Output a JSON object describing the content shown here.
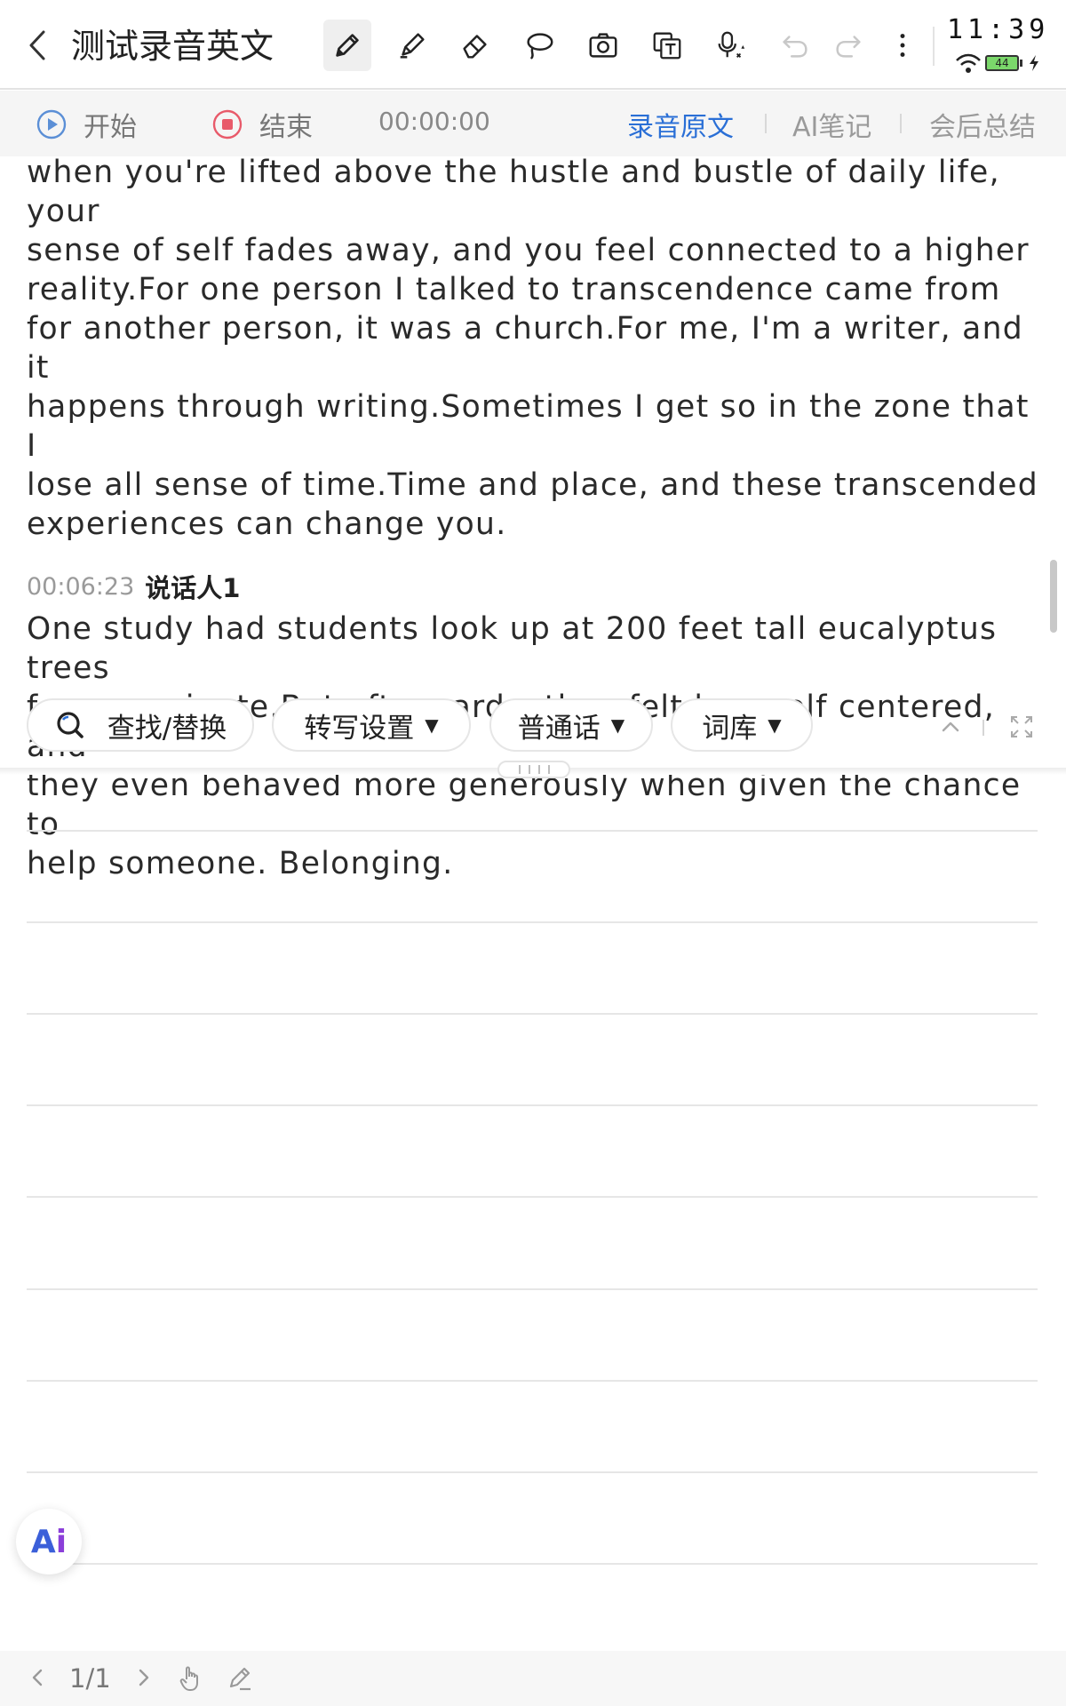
{
  "toolbar": {
    "title": "测试录音英文",
    "tools": [
      "pen-icon",
      "highlighter-icon",
      "eraser-icon",
      "lasso-icon",
      "camera-icon",
      "text-recognition-icon",
      "voice-input-icon",
      "undo-icon",
      "redo-icon",
      "more-icon"
    ]
  },
  "status": {
    "time": "11:39",
    "battery": "44"
  },
  "recording": {
    "start_label": "开始",
    "stop_label": "结束",
    "elapsed": "00:00:00",
    "tabs": [
      {
        "label": "录音原文",
        "active": true
      },
      {
        "label": "AI笔记",
        "active": false
      },
      {
        "label": "会后总结",
        "active": false
      }
    ]
  },
  "transcript": {
    "para1": "when you're lifted above the hustle and bustle of daily life, your\nsense of self fades away, and you feel connected to a higher\nreality.For one person I talked to transcendence came from\nfor another person, it was a church.For me, I'm a writer, and it\nhappens through writing.Sometimes I get so in the zone that I\nlose all sense of time.Time and place, and these transcended\nexperiences can change you.",
    "entry": {
      "timestamp": "00:06:23",
      "speaker": "说话人1",
      "text": "One study had students look up at 200 feet tall eucalyptus trees\nfor one minute.But afterwards, they felt less self centered, and\nthey even behaved more generously when given the chance to\nhelp someone. Belonging."
    }
  },
  "controls": {
    "find_replace": "查找/替换",
    "transcribe_settings": "转写设置",
    "language": "普通话",
    "lexicon": "词库"
  },
  "ai_button": {
    "label_a": "A",
    "label_i": "i"
  },
  "pagination": {
    "page": "1/1"
  },
  "colors": {
    "accent": "#2a6fd6",
    "stop_red": "#e85a6a",
    "play_blue": "#5b8fd6"
  }
}
